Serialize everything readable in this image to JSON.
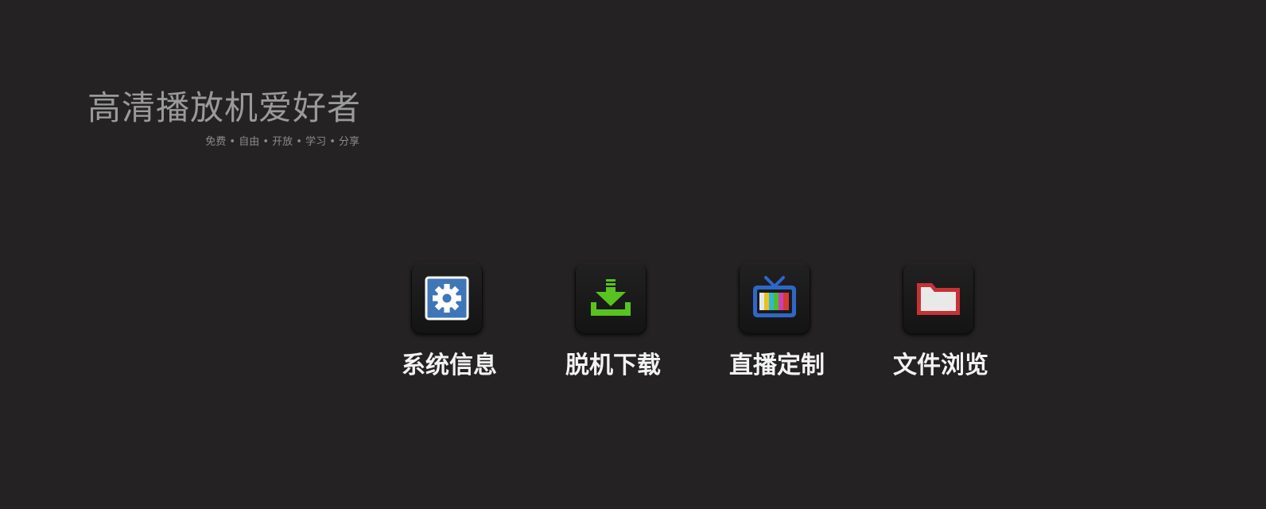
{
  "brand": {
    "title": "高清播放机爱好者",
    "tagline": "免费 • 自由 • 开放 • 学习 • 分享"
  },
  "apps": [
    {
      "label": "系统信息",
      "icon": "gear-icon",
      "color": "#3f76b8"
    },
    {
      "label": "脱机下载",
      "icon": "download-icon",
      "color": "#58c31f"
    },
    {
      "label": "直播定制",
      "icon": "tv-icon",
      "color": "#2f67c8"
    },
    {
      "label": "文件浏览",
      "icon": "folder-icon",
      "color": "#c73235"
    }
  ]
}
